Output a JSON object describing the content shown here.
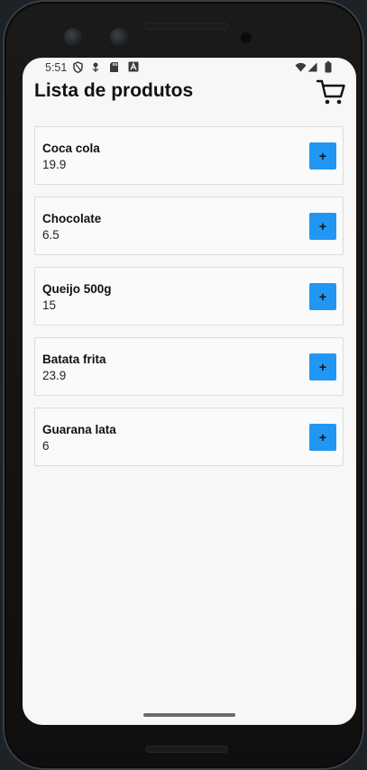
{
  "status_bar": {
    "time": "5:51",
    "left_icons": [
      "shield-icon",
      "usb-debug-icon",
      "sd-card-icon",
      "font-icon"
    ],
    "right_icons": [
      "wifi-icon",
      "signal-icon",
      "battery-icon"
    ]
  },
  "header": {
    "title": "Lista de produtos",
    "cart_icon": "cart-icon"
  },
  "products": [
    {
      "name": "Coca cola",
      "price": "19.9",
      "button_label": "+"
    },
    {
      "name": "Chocolate",
      "price": "6.5",
      "button_label": "+"
    },
    {
      "name": "Queijo 500g",
      "price": "15",
      "button_label": "+"
    },
    {
      "name": "Batata frita",
      "price": "23.9",
      "button_label": "+"
    },
    {
      "name": "Guarana lata",
      "price": "6",
      "button_label": "+"
    }
  ],
  "colors": {
    "add_button": "#2196f3",
    "background": "#f7f7f7",
    "card_border": "#dcdcdc"
  }
}
